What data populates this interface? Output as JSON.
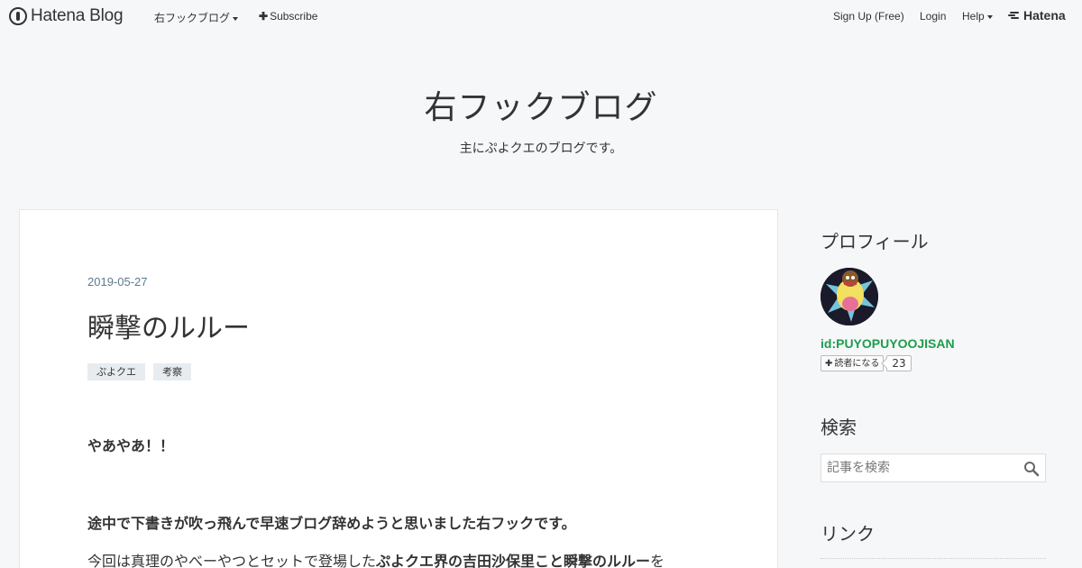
{
  "header": {
    "logo_text": "Hatena Blog",
    "blog_menu_label": "右フックブログ",
    "subscribe_label": "Subscribe",
    "signup_label": "Sign Up (Free)",
    "login_label": "Login",
    "help_label": "Help",
    "hatena_label": "Hatena"
  },
  "blog": {
    "title": "右フックブログ",
    "description": "主にぷよクエのブログです。"
  },
  "entry": {
    "date": "2019-05-27",
    "title": "瞬撃のルルー",
    "categories": [
      "ぷよクエ",
      "考察"
    ],
    "para1": "やあやあ！！",
    "para2": "途中で下書きが吹っ飛んで早速ブログ辞めようと思いました右フックです。",
    "para3_a": "今回は真理のやべーやつとセットで登場した",
    "para3_b": "ぷよクエ界の吉田沙保里こと瞬撃のルルー",
    "para3_c": "を"
  },
  "sidebar": {
    "profile_heading": "プロフィール",
    "user_id": "id:PUYOPUYOOJISAN",
    "subscribe_button": "読者になる",
    "subscriber_count": "23",
    "search_heading": "検索",
    "search_placeholder": "記事を検索",
    "links_heading": "リンク"
  },
  "colors": {
    "background": "#f6f7f9",
    "date_color": "#5d7a8c",
    "user_id_color": "#1d9d4b",
    "category_bg": "#e6ecf0"
  },
  "icons": [
    "hatena-blog-logo-icon",
    "caret-down-icon",
    "plus-icon",
    "hatena-logo-icon",
    "search-icon"
  ]
}
